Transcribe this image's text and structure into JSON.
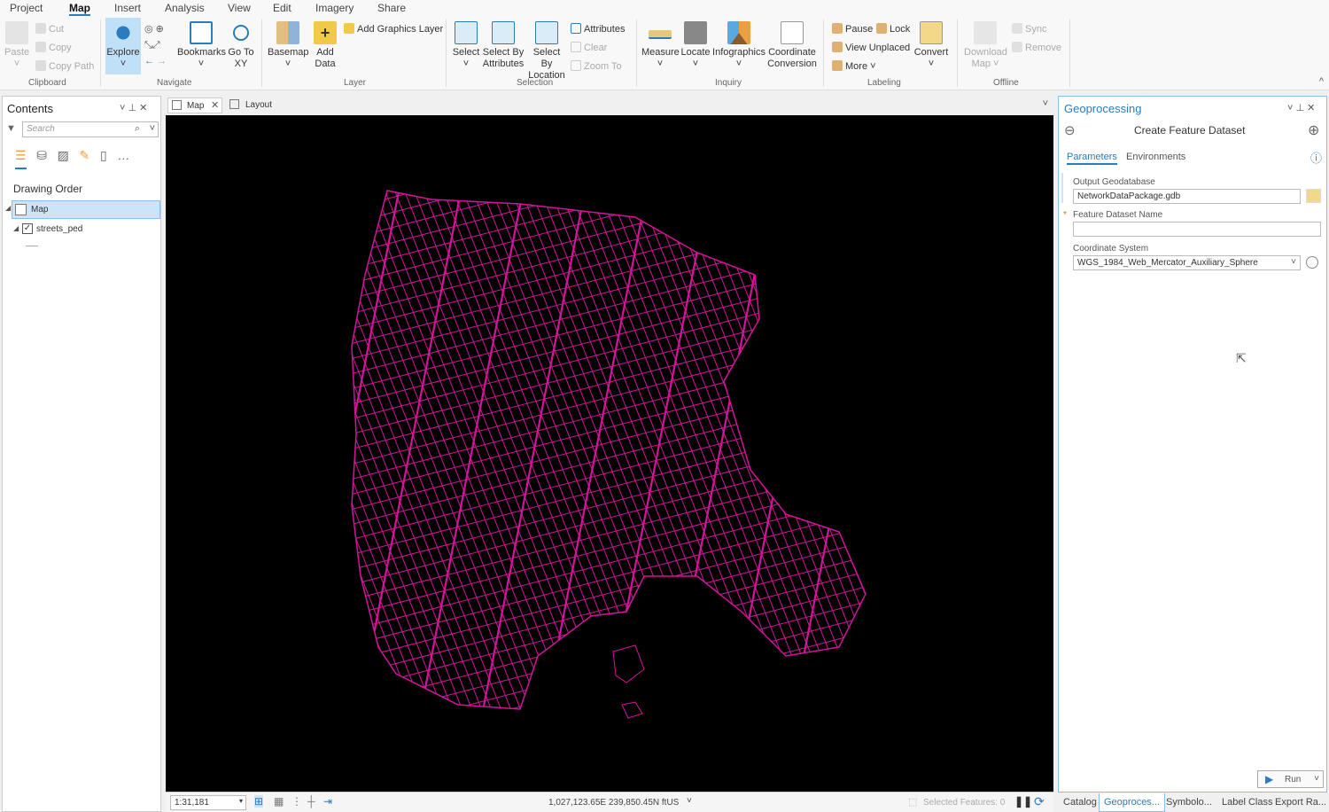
{
  "ribbon_tabs": [
    "Project",
    "Map",
    "Insert",
    "Analysis",
    "View",
    "Edit",
    "Imagery",
    "Share"
  ],
  "active_tab": "Map",
  "clipboard": {
    "paste": "Paste",
    "cut": "Cut",
    "copy": "Copy",
    "copy_path": "Copy Path",
    "label": "Clipboard"
  },
  "navigate": {
    "explore": "Explore",
    "bookmarks": "Bookmarks",
    "go_to_xy": "Go To XY",
    "label": "Navigate"
  },
  "layer": {
    "basemap": "Basemap",
    "add_data": "Add Data",
    "add_graphics": "Add Graphics Layer",
    "label": "Layer"
  },
  "selection": {
    "select": "Select",
    "by_attributes": "Select By Attributes",
    "by_location": "Select By Location",
    "attributes": "Attributes",
    "clear": "Clear",
    "zoom_to": "Zoom To",
    "label": "Selection"
  },
  "inquiry": {
    "measure": "Measure",
    "locate": "Locate",
    "infographics": "Infographics",
    "coordinate_conversion": "Coordinate Conversion",
    "label": "Inquiry"
  },
  "labeling": {
    "pause": "Pause",
    "lock": "Lock",
    "view_unplaced": "View Unplaced",
    "more": "More",
    "convert": "Convert",
    "label": "Labeling"
  },
  "offline": {
    "download_map": "Download Map",
    "sync": "Sync",
    "remove": "Remove",
    "label": "Offline"
  },
  "contents": {
    "title": "Contents",
    "search_placeholder": "Search",
    "drawing_order": "Drawing Order",
    "map_item": "Map",
    "layer_item": "streets_ped"
  },
  "map_tabs": [
    "Map",
    "Layout"
  ],
  "status": {
    "scale": "1:31,181",
    "coordinates": "1,027,123.65E 239,850.45N ftUS",
    "selected_features": "Selected Features: 0"
  },
  "geoprocessing": {
    "title": "Geoprocessing",
    "tool_name": "Create Feature Dataset",
    "tabs": [
      "Parameters",
      "Environments"
    ],
    "output_gdb_label": "Output Geodatabase",
    "output_gdb_value": "NetworkDataPackage.gdb",
    "dataset_name_label": "Feature Dataset Name",
    "dataset_name_value": "",
    "coord_system_label": "Coordinate System",
    "coord_system_value": "WGS_1984_Web_Mercator_Auxiliary_Sphere",
    "run": "Run"
  },
  "bottom_tabs": [
    "Catalog",
    "Geoproces...",
    "Symbolo...",
    "Label Class",
    "Export Ra..."
  ],
  "colors": {
    "accent": "#2b7bbf",
    "streets": "#d4149a",
    "map_bg": "#000000"
  }
}
